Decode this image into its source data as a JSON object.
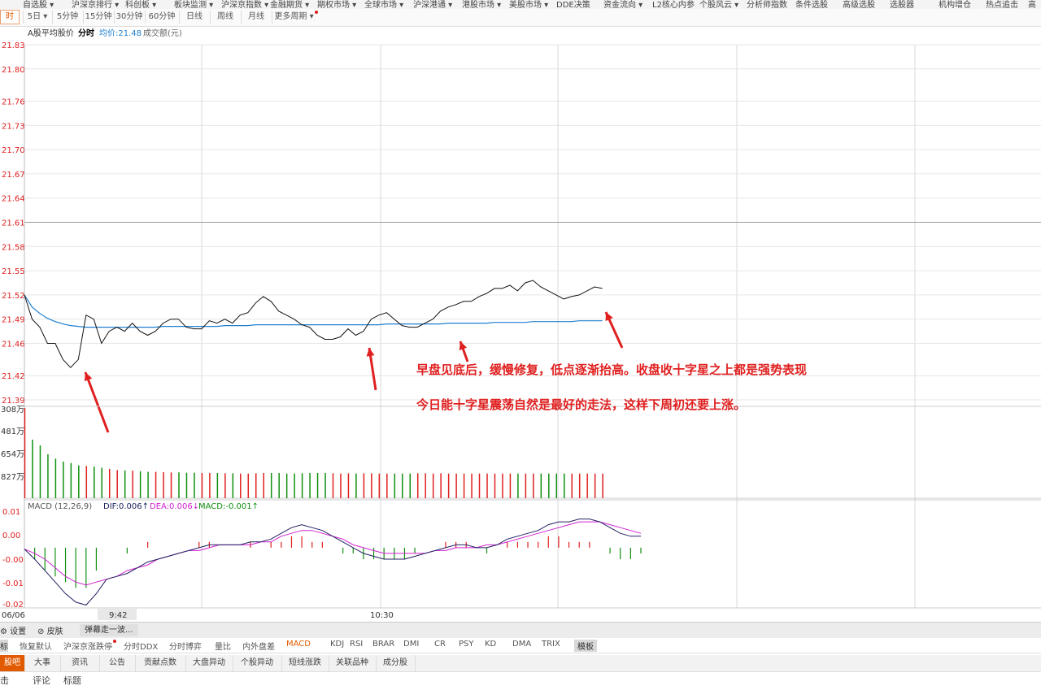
{
  "top_menu": [
    "自选股 ▾",
    "沪深京排行 ▾",
    "科创板 ▾",
    "板块监测 ▾",
    "沪深京指数 ▾",
    "金融期货 ▾",
    "期权市场 ▾",
    "全球市场 ▾",
    "沪深港通 ▾",
    "港股市场 ▾",
    "美股市场 ▾",
    "DDE决策",
    "资金流向 ▾",
    "L2核心内参",
    "个股风云 ▾",
    "分析师指数",
    "条件选股",
    "高级选股",
    "选股器",
    "机构增仓",
    "热点追击",
    "高"
  ],
  "period_tabs": [
    "时",
    "5日 ▾",
    "5分钟",
    "15分钟",
    "30分钟",
    "60分钟",
    "日线",
    "周线",
    "月线",
    "更多周期 ▾"
  ],
  "info": {
    "title": "A股平均股价",
    "mode": "分时",
    "avg_label": "均价:21.48",
    "vol_label": "成交额(元)"
  },
  "price_axis": [
    "21.83",
    "21.80",
    "21.76",
    "21.73",
    "21.70",
    "21.67",
    "21.64",
    "21.61",
    "21.58",
    "21.55",
    "21.52",
    "21.49",
    "21.46",
    "21.42",
    "21.39"
  ],
  "volume_axis": [
    "308万",
    "481万",
    "654万",
    "827万"
  ],
  "macd_header": {
    "name": "MACD (12,26,9)",
    "dif": "DIF:0.006↑",
    "dea": "DEA:0.006↓",
    "macd": "MACD:-0.001↑"
  },
  "macd_axis": [
    "0.01",
    "0.00",
    "-0.00",
    "-0.01",
    "-0.02"
  ],
  "time_axis": [
    "06/06",
    "9:42",
    "10:30"
  ],
  "annotations": [
    "早盘见底后，缓慢修复，低点逐渐抬高。收盘收十字星之上都是强势表现",
    "今日能十字星震荡自然是最好的走法，这样下周初还要上涨。"
  ],
  "toolbar": {
    "settings": "设置",
    "skin": "皮肤",
    "barrage": "弹幕走一波..."
  },
  "indicator_tabs": [
    "标",
    "恢复默认",
    "沪深京涨跌停",
    "分时DDX",
    "分时博弈",
    "量比",
    "内外盘差",
    "MACD",
    "KDJ",
    "RSI",
    "BRAR",
    "DMI",
    "CR",
    "PSY",
    "KD",
    "DMA",
    "TRIX",
    "模板"
  ],
  "bottom_tabs": [
    "股吧",
    "大事",
    "资讯",
    "公告",
    "贡献点数",
    "大盘异动",
    "个股异动",
    "短线涨跌",
    "关联品种",
    "成分股"
  ],
  "sub_tabs": [
    "击",
    "评论",
    "标题"
  ],
  "colors": {
    "accent": "#e25a00",
    "up": "#e02020",
    "down": "#109010",
    "avg_line": "#1e7fd0",
    "dea_line": "#d020d0",
    "dif_line": "#202060"
  },
  "chart_data": {
    "type": "line",
    "price_series": {
      "x_minutes": [
        0,
        3,
        6,
        9,
        12,
        15,
        18,
        21,
        24,
        27,
        30,
        33,
        36,
        39,
        42,
        45,
        48,
        51,
        54,
        57,
        60,
        63,
        66,
        69,
        72,
        75,
        78,
        81,
        84,
        87,
        90,
        93,
        96,
        99,
        102,
        105,
        108,
        111,
        114,
        117,
        120,
        123,
        126,
        129,
        132,
        135,
        138,
        141,
        144,
        147,
        150,
        153,
        156,
        159,
        162,
        165,
        168,
        171,
        174,
        177,
        180,
        183,
        186,
        189,
        192,
        195,
        198,
        201,
        204,
        207,
        210,
        213,
        216,
        219,
        222,
        225,
        228,
        231,
        234,
        237,
        240
      ],
      "values": [
        21.52,
        21.49,
        21.48,
        21.46,
        21.46,
        21.44,
        21.43,
        21.44,
        21.495,
        21.49,
        21.46,
        21.475,
        21.48,
        21.475,
        21.485,
        21.475,
        21.47,
        21.475,
        21.485,
        21.49,
        21.49,
        21.48,
        21.478,
        21.478,
        21.488,
        21.485,
        21.49,
        21.485,
        21.495,
        21.498,
        21.51,
        21.518,
        21.512,
        21.5,
        21.495,
        21.49,
        21.483,
        21.48,
        21.47,
        21.465,
        21.465,
        21.468,
        21.478,
        21.47,
        21.475,
        21.49,
        21.495,
        21.498,
        21.49,
        21.482,
        21.48,
        21.48,
        21.485,
        21.49,
        21.5,
        21.505,
        21.508,
        21.512,
        21.512,
        21.518,
        21.522,
        21.528,
        21.528,
        21.532,
        21.525,
        21.535,
        21.538,
        21.53,
        21.525,
        21.52,
        21.515,
        21.518,
        21.52,
        21.525,
        21.53,
        21.528
      ],
      "avg_values": [
        21.52,
        21.505,
        21.497,
        21.491,
        21.487,
        21.484,
        21.482,
        21.481,
        21.48,
        21.48,
        21.48,
        21.48,
        21.48,
        21.48,
        21.48,
        21.48,
        21.48,
        21.48,
        21.481,
        21.481,
        21.481,
        21.481,
        21.481,
        21.481,
        21.481,
        21.481,
        21.482,
        21.482,
        21.482,
        21.482,
        21.483,
        21.483,
        21.483,
        21.483,
        21.483,
        21.483,
        21.483,
        21.483,
        21.483,
        21.483,
        21.483,
        21.483,
        21.483,
        21.483,
        21.483,
        21.483,
        21.483,
        21.484,
        21.484,
        21.484,
        21.484,
        21.484,
        21.484,
        21.484,
        21.484,
        21.485,
        21.485,
        21.485,
        21.485,
        21.485,
        21.485,
        21.486,
        21.486,
        21.486,
        21.486,
        21.486,
        21.487,
        21.487,
        21.487,
        21.487,
        21.487,
        21.487,
        21.488,
        21.488,
        21.488,
        21.488
      ],
      "ylim": [
        21.39,
        21.83
      ],
      "ref_price": 21.61
    },
    "volume_series": {
      "values": [
        308,
        200,
        180,
        150,
        135,
        125,
        120,
        112,
        110,
        108,
        104,
        100,
        96,
        95,
        94,
        92,
        90,
        90,
        89,
        88,
        88,
        87,
        87,
        86,
        86,
        86,
        85,
        85,
        84,
        84,
        85,
        86,
        86,
        86,
        84,
        84,
        85,
        86,
        86,
        86,
        85,
        84,
        85,
        84,
        85,
        85,
        84,
        84,
        84,
        84,
        84,
        85,
        85,
        84,
        85,
        84,
        84,
        84,
        84,
        84,
        84,
        84,
        84,
        84,
        84,
        84,
        84,
        84,
        84,
        84,
        84,
        84,
        84,
        84,
        84,
        84
      ],
      "colors": [
        "r",
        "g",
        "g",
        "g",
        "g",
        "g",
        "g",
        "g",
        "r",
        "g",
        "g",
        "r",
        "r",
        "g",
        "r",
        "g",
        "g",
        "r",
        "r",
        "r",
        "g",
        "g",
        "g",
        "r",
        "r",
        "g",
        "r",
        "g",
        "r",
        "r",
        "r",
        "r",
        "g",
        "g",
        "g",
        "g",
        "g",
        "g",
        "g",
        "g",
        "r",
        "r",
        "r",
        "g",
        "r",
        "r",
        "r",
        "r",
        "g",
        "g",
        "g",
        "r",
        "r",
        "r",
        "r",
        "r",
        "r",
        "r",
        "r",
        "r",
        "r",
        "r",
        "r",
        "r",
        "g",
        "r",
        "r",
        "g",
        "g",
        "g",
        "g",
        "r",
        "r",
        "r",
        "r",
        "r"
      ]
    },
    "macd_series": {
      "dif": [
        -0.0005,
        -0.004,
        -0.008,
        -0.012,
        -0.016,
        -0.019,
        -0.02,
        -0.016,
        -0.011,
        -0.01,
        -0.009,
        -0.007,
        -0.005,
        -0.004,
        -0.003,
        -0.002,
        -0.001,
        0.0,
        0.001,
        0.001,
        0.001,
        0.001,
        0.002,
        0.002,
        0.003,
        0.005,
        0.007,
        0.008,
        0.007,
        0.006,
        0.004,
        0.002,
        0.0,
        -0.002,
        -0.003,
        -0.004,
        -0.004,
        -0.004,
        -0.003,
        -0.002,
        -0.001,
        0.0,
        0.001,
        0.001,
        0.0,
        0.0,
        0.001,
        0.003,
        0.004,
        0.005,
        0.006,
        0.008,
        0.009,
        0.009,
        0.01,
        0.01,
        0.009,
        0.007,
        0.005,
        0.004,
        0.004
      ],
      "dea": [
        -0.0005,
        -0.002,
        -0.004,
        -0.007,
        -0.01,
        -0.012,
        -0.013,
        -0.012,
        -0.011,
        -0.01,
        -0.008,
        -0.007,
        -0.006,
        -0.004,
        -0.003,
        -0.002,
        -0.001,
        -0.001,
        0.0,
        0.001,
        0.001,
        0.001,
        0.001,
        0.002,
        0.002,
        0.004,
        0.005,
        0.006,
        0.006,
        0.005,
        0.004,
        0.003,
        0.001,
        0.0,
        -0.001,
        -0.002,
        -0.002,
        -0.002,
        -0.002,
        -0.002,
        -0.001,
        -0.001,
        0.0,
        0.0,
        0.0,
        0.001,
        0.001,
        0.002,
        0.003,
        0.004,
        0.005,
        0.006,
        0.007,
        0.008,
        0.009,
        0.009,
        0.009,
        0.008,
        0.007,
        0.006,
        0.005
      ],
      "ylim": [
        -0.021,
        0.013
      ]
    }
  }
}
